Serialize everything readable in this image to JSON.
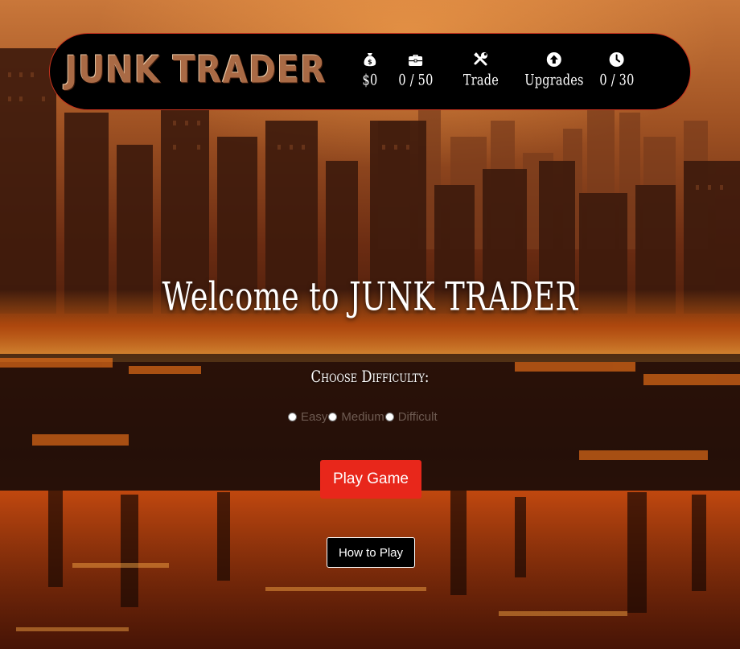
{
  "header": {
    "logo": "JUNK TRADER",
    "stats": {
      "money": {
        "icon": "money-bag-icon",
        "value": "$0"
      },
      "inventory": {
        "icon": "briefcase-icon",
        "value": "0 / 50"
      },
      "trade": {
        "icon": "tools-icon",
        "label": "Trade"
      },
      "upgrades": {
        "icon": "arrow-up-circle-icon",
        "label": "Upgrades"
      },
      "time": {
        "icon": "clock-icon",
        "value": "0 / 30"
      }
    },
    "border_color": "#c8321e"
  },
  "main": {
    "welcome": "Welcome to JUNK TRADER",
    "choose_difficulty": "Choose Difficulty:",
    "difficulty_options": [
      "Easy",
      "Medium",
      "Difficult"
    ],
    "play_button": "Play Game",
    "how_to_play_button": "How to Play"
  },
  "colors": {
    "accent": "#e8271b",
    "header_bg": "#000000",
    "option_text": "#6e5b52"
  }
}
